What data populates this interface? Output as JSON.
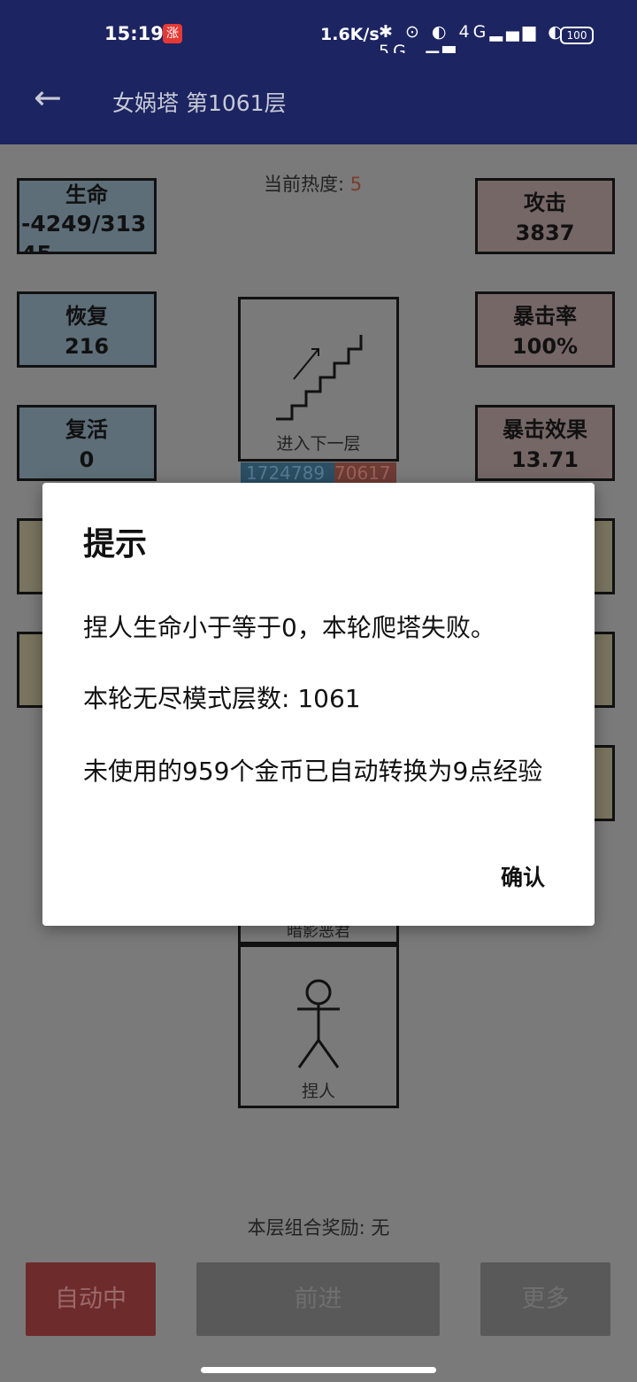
{
  "status_bar": {
    "time": "15:19",
    "badge": "涨",
    "net_speed": "1.6K/s",
    "network_icons": "✱ ⊙ ◐ 4G▂▄▆ ◐ 5G▂▄▆",
    "battery": "100"
  },
  "app_bar": {
    "back_icon": "←",
    "title": "女娲塔 第1061层"
  },
  "stats_left": [
    {
      "label": "生命",
      "value": "-4249/31345"
    },
    {
      "label": "恢复",
      "value": "216"
    },
    {
      "label": "复活",
      "value": "0"
    }
  ],
  "stats_right": [
    {
      "label": "攻击",
      "value": "3837"
    },
    {
      "label": "暴击率",
      "value": "100%"
    },
    {
      "label": "暴击效果",
      "value": "13.71"
    }
  ],
  "heat": {
    "label": "当前热度:",
    "value": "5"
  },
  "stairs_card": {
    "label": "进入下一层"
  },
  "enemy_hp": {
    "blue_value": "1724789",
    "red_value": "70617"
  },
  "enemy_name": "暗影恶君",
  "hero_card": {
    "label": "捏人"
  },
  "combo_bonus": "本层组合奖励: 无",
  "buttons": {
    "auto": "自动中",
    "forward": "前进",
    "more": "更多"
  },
  "dialog": {
    "title": "提示",
    "line1": "捏人生命小于等于0，本轮爬塔失败。",
    "line2": "本轮无尽模式层数: 1061",
    "line3": "未使用的959个金币已自动转换为9点经验",
    "confirm": "确认"
  }
}
